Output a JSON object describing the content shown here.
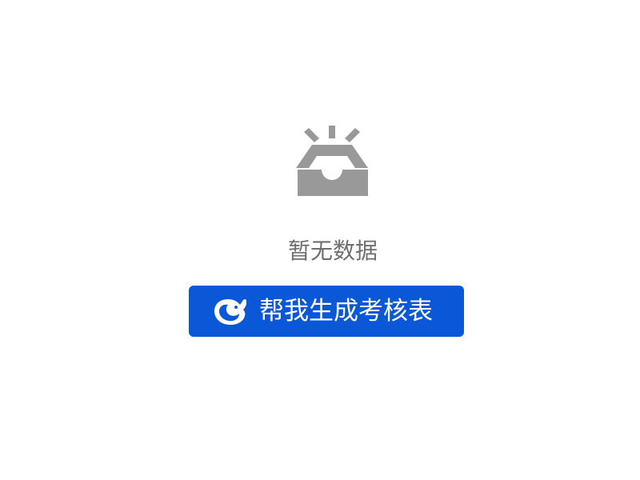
{
  "empty_state": {
    "icon": "empty-inbox-icon",
    "message": "暂无数据"
  },
  "action": {
    "icon": "deepseek-whale-icon",
    "label": "帮我生成考核表",
    "background": "#0a58d8",
    "text_color": "#ffffff"
  },
  "colors": {
    "icon_gray": "#999999",
    "message_gray": "#6e6e6e",
    "page_background": "#ffffff"
  }
}
